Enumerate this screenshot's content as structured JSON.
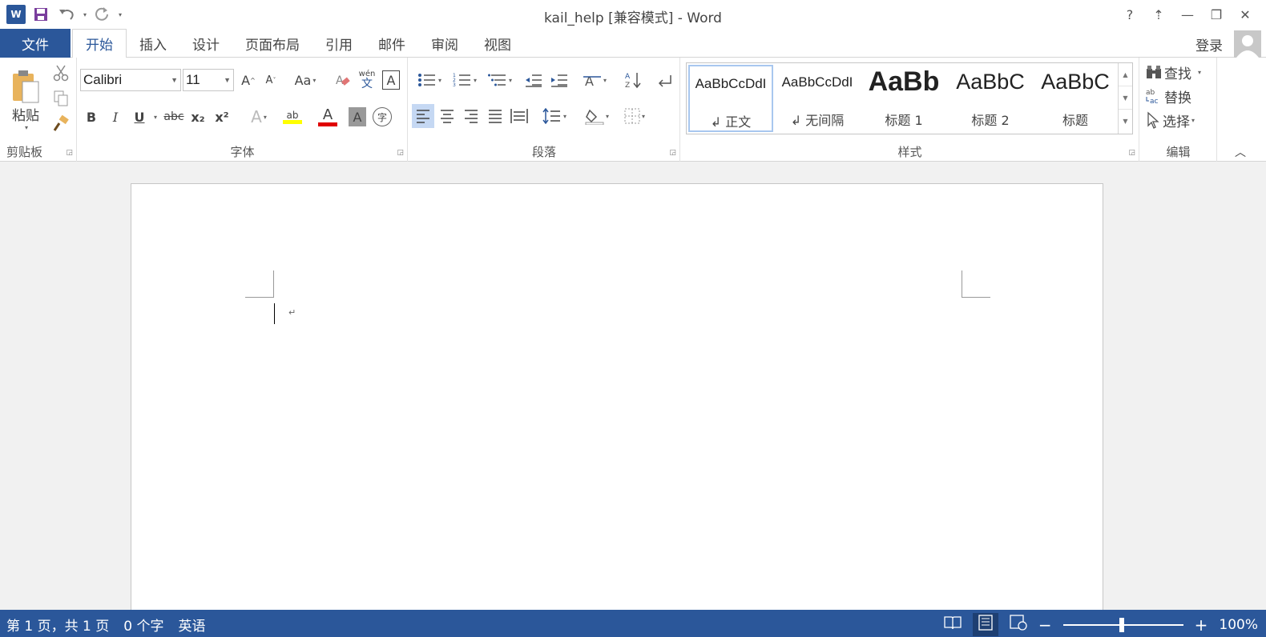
{
  "window": {
    "title": "kail_help [兼容模式] - Word",
    "controls": [
      "?",
      "⇡",
      "—",
      "❐",
      "✕"
    ]
  },
  "qat": {
    "app_icon": "W",
    "customize": "▾"
  },
  "tabs": {
    "file": "文件",
    "items": [
      "开始",
      "插入",
      "设计",
      "页面布局",
      "引用",
      "邮件",
      "审阅",
      "视图"
    ],
    "active": "开始",
    "login": "登录"
  },
  "ribbon": {
    "clipboard": {
      "label": "剪贴板",
      "paste": "粘贴"
    },
    "font": {
      "label": "字体",
      "family": "Calibri",
      "size": "11",
      "grow": "A",
      "shrink": "A",
      "case": "Aa",
      "phonetic": "wén",
      "phonetic_char": "文",
      "border_char": "A",
      "bold": "B",
      "italic": "I",
      "underline": "U",
      "strike": "abc",
      "subscript": "x₂",
      "superscript": "x²",
      "effects": "A",
      "highlight": "ab",
      "font_color": "A",
      "shading": "A",
      "enclose": "字",
      "highlight_color": "#ffff00",
      "font_color_value": "#e00000"
    },
    "paragraph": {
      "label": "段落"
    },
    "styles": {
      "label": "样式",
      "items": [
        {
          "sample": "AaBbCcDdI",
          "name": "↲ 正文"
        },
        {
          "sample": "AaBbCcDdI",
          "name": "↲ 无间隔"
        },
        {
          "sample": "AaBb",
          "name": "标题 1"
        },
        {
          "sample": "AaBbC",
          "name": "标题 2"
        },
        {
          "sample": "AaBbC",
          "name": "标题"
        }
      ]
    },
    "editing": {
      "label": "编辑",
      "find": "查找",
      "replace": "替换",
      "select": "选择"
    }
  },
  "document": {
    "paragraph_mark": "↵"
  },
  "status": {
    "page": "第 1 页，共 1 页",
    "words": "0 个字",
    "language": "英语",
    "zoom": "100%",
    "zoom_out": "−",
    "zoom_in": "+"
  },
  "colors": {
    "accent": "#2b579a"
  }
}
